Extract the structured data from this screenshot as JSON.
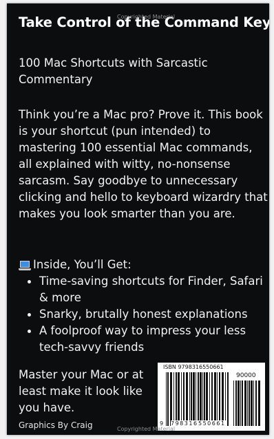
{
  "cover": {
    "title": "Take Control of the Command Key",
    "subtitle": "100 Mac Shortcuts with Sarcastic Commentary",
    "intro": "Think you’re a Mac pro? Prove it. This book is your shortcut (pun intended) to mastering 100 essential Mac commands, all explained with witty, no-nonsense sarcasm. Say goodbye to unnecessary clicking and hello to keyboard wizardry that makes you look smarter than you are.",
    "inside_icon": "laptop-icon",
    "inside_heading": "Inside, You’ll Get:",
    "bullets": [
      "Time-saving shortcuts for Finder, Safari & more",
      "Snarky, brutally honest explanations",
      "A foolproof way to impress your less tech-savvy friends"
    ],
    "closing": "Master your Mac or at least make it look like you have.",
    "credit": "Graphics By Craig"
  },
  "watermark": "Copyrighted Material",
  "barcode": {
    "isbn_label": "ISBN 9798316550661",
    "price_code": "90000",
    "digits_lead": "9",
    "digits_left": "798316",
    "digits_right": "550661"
  },
  "colors": {
    "cover_bg": "#0c0d0f",
    "text": "#f2f2f2",
    "page_bg": "#f1f1f1"
  }
}
